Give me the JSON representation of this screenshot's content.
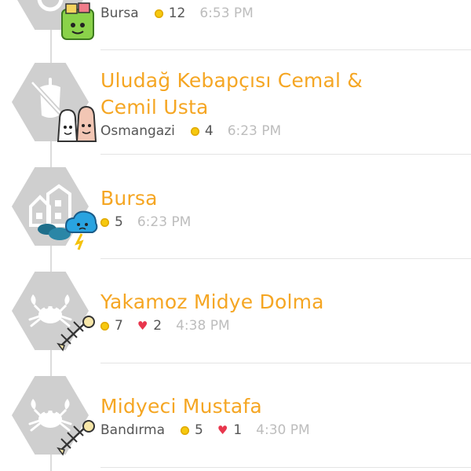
{
  "checkins": [
    {
      "title": "",
      "place": "Bursa",
      "coins": "12",
      "likes": "",
      "time": "6:53 PM",
      "category_icon": "partial-icon",
      "sticker": "green-bag-sticker"
    },
    {
      "title_line1": "Uludağ Kebapçısı Cemal &",
      "title_line2": "Cemil Usta",
      "place": "Osmangazi",
      "coins": "4",
      "time": "6:23 PM",
      "category_icon": "meat-skewer-icon",
      "sticker": "salt-pepper-shakers-sticker"
    },
    {
      "title": "Bursa",
      "coins": "5",
      "time": "6:23 PM",
      "category_icon": "city-buildings-icon",
      "sticker": "storm-cloud-sticker"
    },
    {
      "title": "Yakamoz Midye Dolma",
      "coins": "7",
      "likes": "2",
      "time": "4:38 PM",
      "category_icon": "crab-icon",
      "sticker": "fish-bone-sticker"
    },
    {
      "title": "Midyeci Mustafa",
      "place": "Bandırma",
      "coins": "5",
      "likes": "1",
      "time": "4:30 PM",
      "category_icon": "crab-icon",
      "sticker": "fish-bone-sticker"
    }
  ],
  "colors": {
    "title": "#f5a623",
    "coin": "#f6c90e",
    "heart": "#e8364d",
    "time": "#bdbdbd",
    "hex": "#cfcfcf"
  },
  "glyphs": {
    "heart": "♥"
  }
}
